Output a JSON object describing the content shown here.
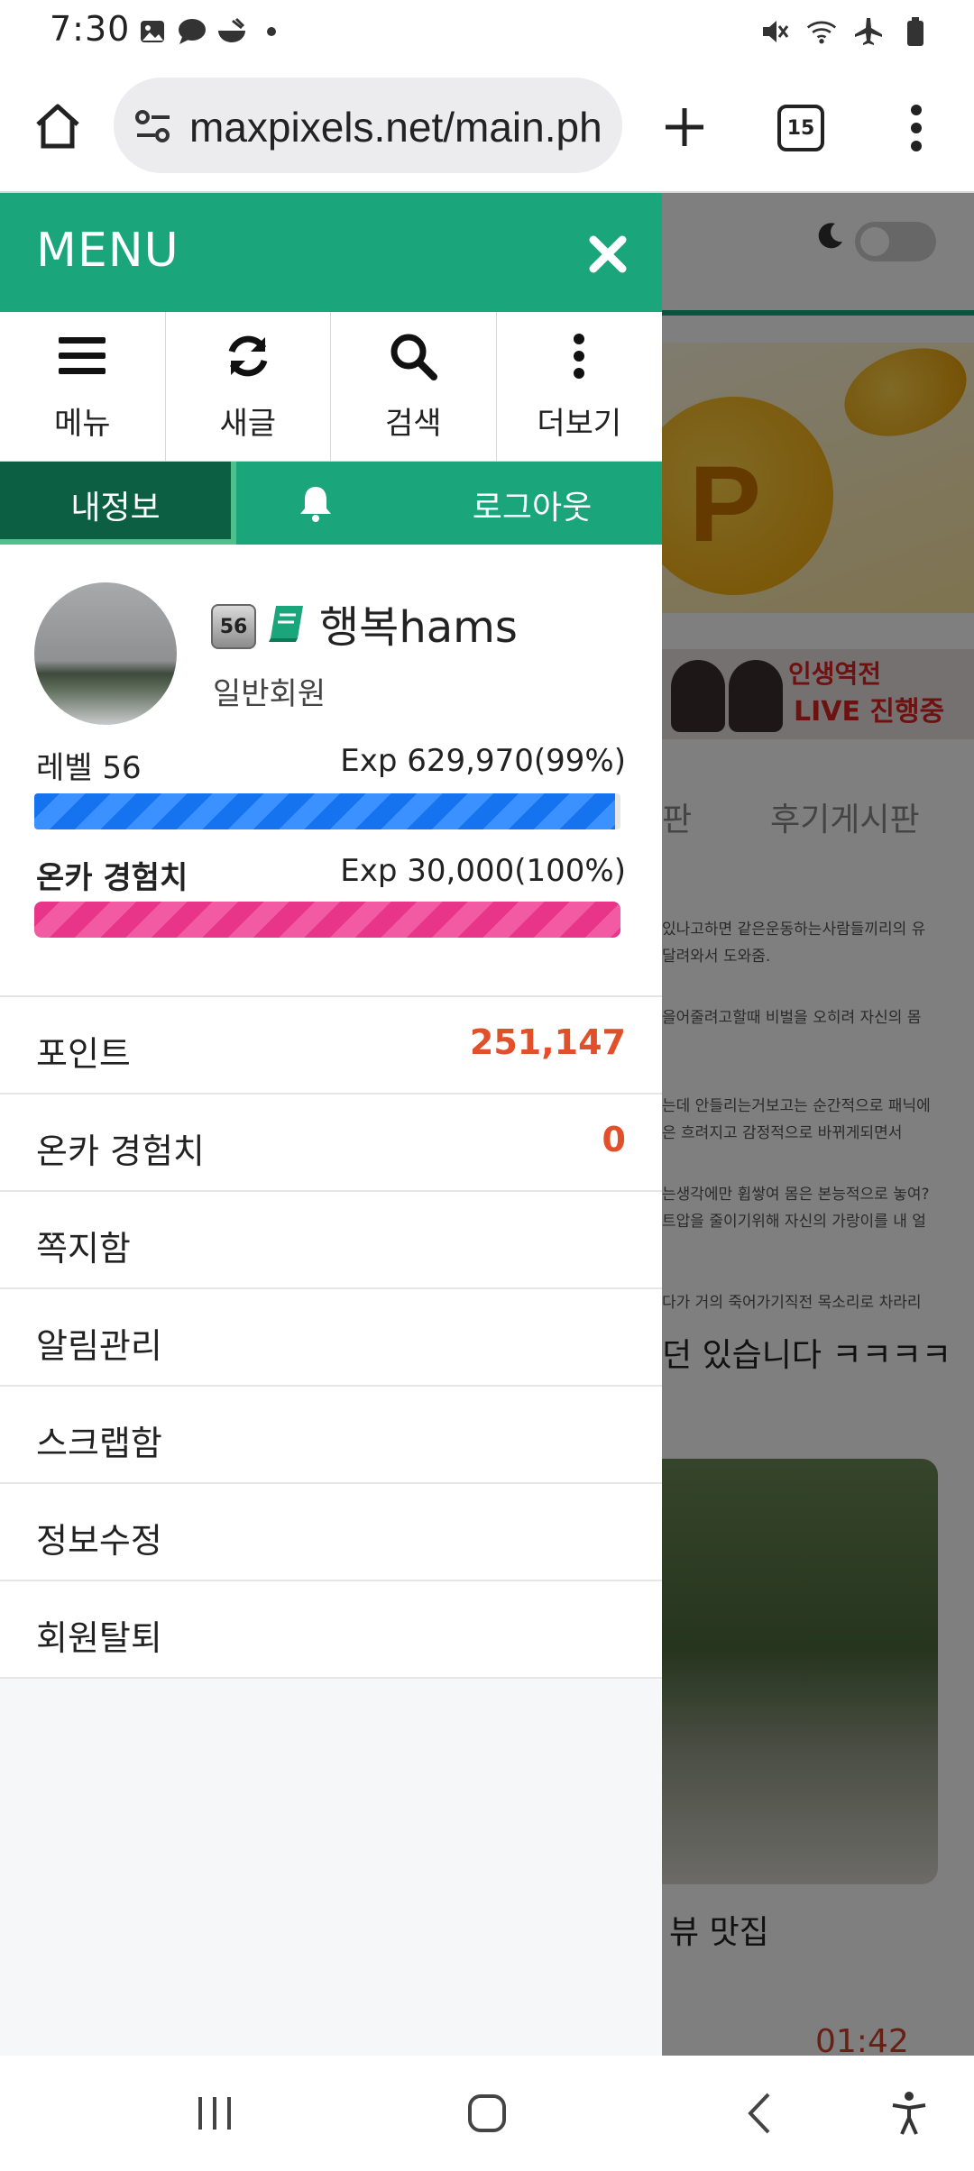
{
  "status_bar": {
    "time": "7:30",
    "left_icons": [
      "gallery-icon",
      "chat-icon",
      "bowl-icon",
      "dot-icon"
    ],
    "right_icons": [
      "mute-icon",
      "wifi-icon",
      "airplane-icon",
      "battery-icon"
    ]
  },
  "browser": {
    "url": "maxpixels.net/main.ph",
    "tab_count": "15"
  },
  "menu": {
    "title": "MENU",
    "quick_actions": [
      {
        "label": "메뉴",
        "icon": "hamburger-icon"
      },
      {
        "label": "새글",
        "icon": "refresh-icon"
      },
      {
        "label": "검색",
        "icon": "search-icon"
      },
      {
        "label": "더보기",
        "icon": "more-vertical-icon"
      }
    ],
    "tabs": {
      "my_info": "내정보",
      "logout": "로그아웃"
    },
    "profile": {
      "level_badge": "56",
      "nickname": "행복hams",
      "member_type": "일반회원",
      "level_label": "레벨 56",
      "level_exp": "Exp 629,970(99%)",
      "level_progress": 0.99,
      "onca_label": "온카 경험치",
      "onca_exp": "Exp 30,000(100%)",
      "onca_progress": 1.0
    },
    "items": [
      {
        "label": "포인트",
        "value": "251,147"
      },
      {
        "label": "온카 경험치",
        "value": "0"
      },
      {
        "label": "쪽지함",
        "value": ""
      },
      {
        "label": "알림관리",
        "value": ""
      },
      {
        "label": "스크랩함",
        "value": ""
      },
      {
        "label": "정보수정",
        "value": ""
      },
      {
        "label": "회원탈퇴",
        "value": ""
      }
    ]
  },
  "background_page": {
    "tab_left": "판",
    "tab_right": "후기게시판",
    "banner_line1": "인생역전",
    "banner_line2": "LIVE 진행중",
    "text_lines": [
      "있나고하면 같은운동하는사람들끼리의 유",
      "달려와서 도와줌.",
      "을어줄려고할때 비벌을 오히려 자신의 몸",
      "는데 안들리는거보고는 순간적으로 패닉에",
      "은 흐려지고 감정적으로 바뀌게되면서",
      "는생각에만 휩쌓여 몸은 본능적으로 놓여?",
      "트압을 줄이기위해 자신의 가랑이를 내 얼",
      "다가 거의 죽어가기직전 목소리로 차라리"
    ],
    "big_line": "던 있습니다 ㅋㅋㅋㅋ",
    "photo_title": "뷰 맛집",
    "video_time": "01:42"
  },
  "colors": {
    "brand_green": "#1aa57a",
    "dark_green": "#0d5f43",
    "level_bar": "#1673f0",
    "onca_bar": "#e8358a",
    "value_orange": "#e0502a"
  }
}
